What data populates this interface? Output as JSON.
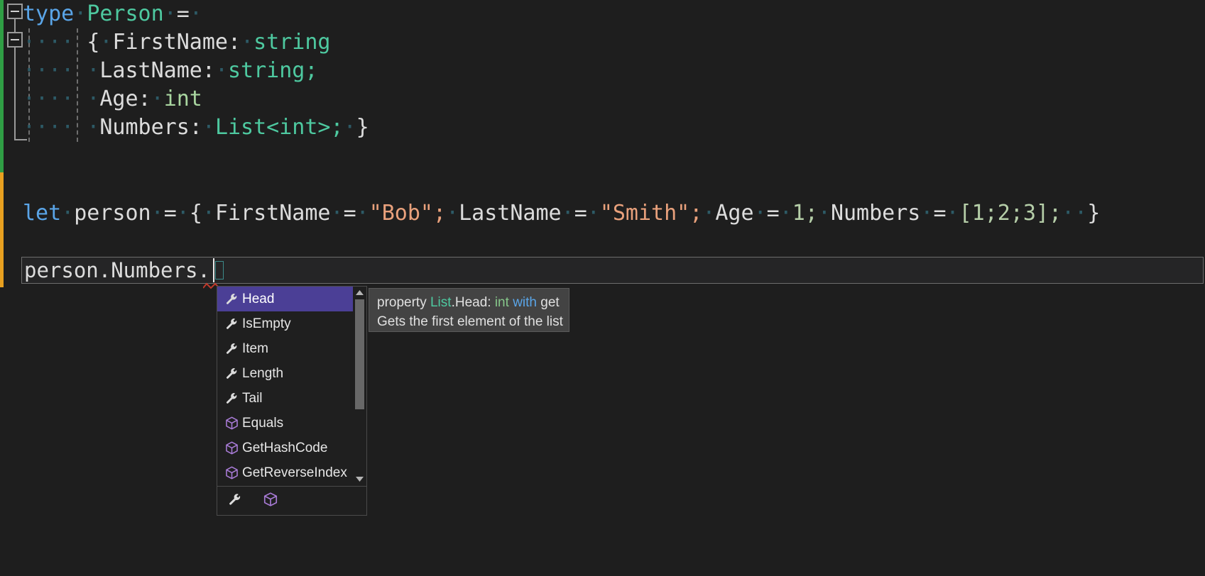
{
  "app": {
    "kind": "code-editor",
    "language": "F#",
    "theme": "dark",
    "background": "#1e1e1e"
  },
  "colors": {
    "background": "#1e1e1e",
    "keyword": "#5aa5e8",
    "type": "#4ec9a0",
    "string": "#e9a17c",
    "number": "#b5cea8",
    "plain": "#dcdcdc",
    "selection": "#4b3f96",
    "tooltip_bg": "#434343",
    "changebar_saved": "#2f9e44",
    "changebar_unsaved": "#e8a020"
  },
  "editor": {
    "lines": [
      {
        "indent_dots": 0,
        "tokens": [
          {
            "t": "type",
            "c": "keyword"
          },
          {
            "t": "·",
            "c": "dot"
          },
          {
            "t": "Person",
            "c": "type"
          },
          {
            "t": "·",
            "c": "dot"
          },
          {
            "t": "=",
            "c": "plain"
          },
          {
            "t": "·",
            "c": "dot"
          }
        ]
      },
      {
        "indent_dots": 4,
        "tokens": [
          {
            "t": "{",
            "c": "plain"
          },
          {
            "t": "·",
            "c": "dot"
          },
          {
            "t": "FirstName:",
            "c": "plain"
          },
          {
            "t": "·",
            "c": "dot"
          },
          {
            "t": "string",
            "c": "type"
          }
        ]
      },
      {
        "indent_dots": 4,
        "tokens": [
          {
            "t": "·",
            "c": "dot"
          },
          {
            "t": "LastName:",
            "c": "plain"
          },
          {
            "t": "·",
            "c": "dot"
          },
          {
            "t": "string;",
            "c": "type"
          }
        ]
      },
      {
        "indent_dots": 4,
        "tokens": [
          {
            "t": "·",
            "c": "dot"
          },
          {
            "t": "Age:",
            "c": "plain"
          },
          {
            "t": "·",
            "c": "dot"
          },
          {
            "t": "int",
            "c": "int"
          }
        ]
      },
      {
        "indent_dots": 4,
        "tokens": [
          {
            "t": "·",
            "c": "dot"
          },
          {
            "t": "Numbers:",
            "c": "plain"
          },
          {
            "t": "·",
            "c": "dot"
          },
          {
            "t": "List<int>;",
            "c": "type"
          },
          {
            "t": "·",
            "c": "dot"
          },
          {
            "t": "}",
            "c": "plain"
          }
        ]
      }
    ],
    "let_line": [
      {
        "t": "let",
        "c": "keyword"
      },
      {
        "t": "·",
        "c": "dot"
      },
      {
        "t": "person",
        "c": "plain"
      },
      {
        "t": "·",
        "c": "dot"
      },
      {
        "t": "=",
        "c": "plain"
      },
      {
        "t": "·",
        "c": "dot"
      },
      {
        "t": "{",
        "c": "plain"
      },
      {
        "t": "·",
        "c": "dot"
      },
      {
        "t": "FirstName",
        "c": "plain"
      },
      {
        "t": "·",
        "c": "dot"
      },
      {
        "t": "=",
        "c": "plain"
      },
      {
        "t": "·",
        "c": "dot"
      },
      {
        "t": "\"Bob\";",
        "c": "string"
      },
      {
        "t": "·",
        "c": "dot"
      },
      {
        "t": "LastName",
        "c": "plain"
      },
      {
        "t": "·",
        "c": "dot"
      },
      {
        "t": "=",
        "c": "plain"
      },
      {
        "t": "·",
        "c": "dot"
      },
      {
        "t": "\"Smith\";",
        "c": "string"
      },
      {
        "t": "·",
        "c": "dot"
      },
      {
        "t": "Age",
        "c": "plain"
      },
      {
        "t": "·",
        "c": "dot"
      },
      {
        "t": "=",
        "c": "plain"
      },
      {
        "t": "·",
        "c": "dot"
      },
      {
        "t": "1;",
        "c": "number"
      },
      {
        "t": "·",
        "c": "dot"
      },
      {
        "t": "Numbers",
        "c": "plain"
      },
      {
        "t": "·",
        "c": "dot"
      },
      {
        "t": "=",
        "c": "plain"
      },
      {
        "t": "·",
        "c": "dot"
      },
      {
        "t": "[1;2;3];",
        "c": "number"
      },
      {
        "t": "··",
        "c": "dot"
      },
      {
        "t": "}",
        "c": "plain"
      }
    ],
    "current_statement": "person.Numbers.",
    "fold_markers": [
      "collapse-all",
      "collapse-record"
    ]
  },
  "intellisense": {
    "items": [
      {
        "label": "Head",
        "icon": "property-wrench-icon",
        "selected": true
      },
      {
        "label": "IsEmpty",
        "icon": "property-wrench-icon",
        "selected": false
      },
      {
        "label": "Item",
        "icon": "property-wrench-icon",
        "selected": false
      },
      {
        "label": "Length",
        "icon": "property-wrench-icon",
        "selected": false
      },
      {
        "label": "Tail",
        "icon": "property-wrench-icon",
        "selected": false
      },
      {
        "label": "Equals",
        "icon": "method-cube-icon",
        "selected": false
      },
      {
        "label": "GetHashCode",
        "icon": "method-cube-icon",
        "selected": false
      },
      {
        "label": "GetReverseIndex",
        "icon": "method-cube-icon",
        "selected": false
      }
    ],
    "scrollbar": {
      "up_arrow": "scroll-up-arrow-icon",
      "down_arrow": "scroll-down-arrow-icon"
    },
    "filters": [
      {
        "name": "filter-properties",
        "icon": "property-wrench-icon"
      },
      {
        "name": "filter-methods",
        "icon": "method-cube-icon"
      }
    ]
  },
  "tooltip": {
    "signature": {
      "prefix": "property ",
      "owner": "List",
      "member": ".Head: ",
      "return_type": "int",
      "space": " ",
      "with_kw": "with",
      "accessor": " get"
    },
    "description": "Gets the first element of the list"
  }
}
